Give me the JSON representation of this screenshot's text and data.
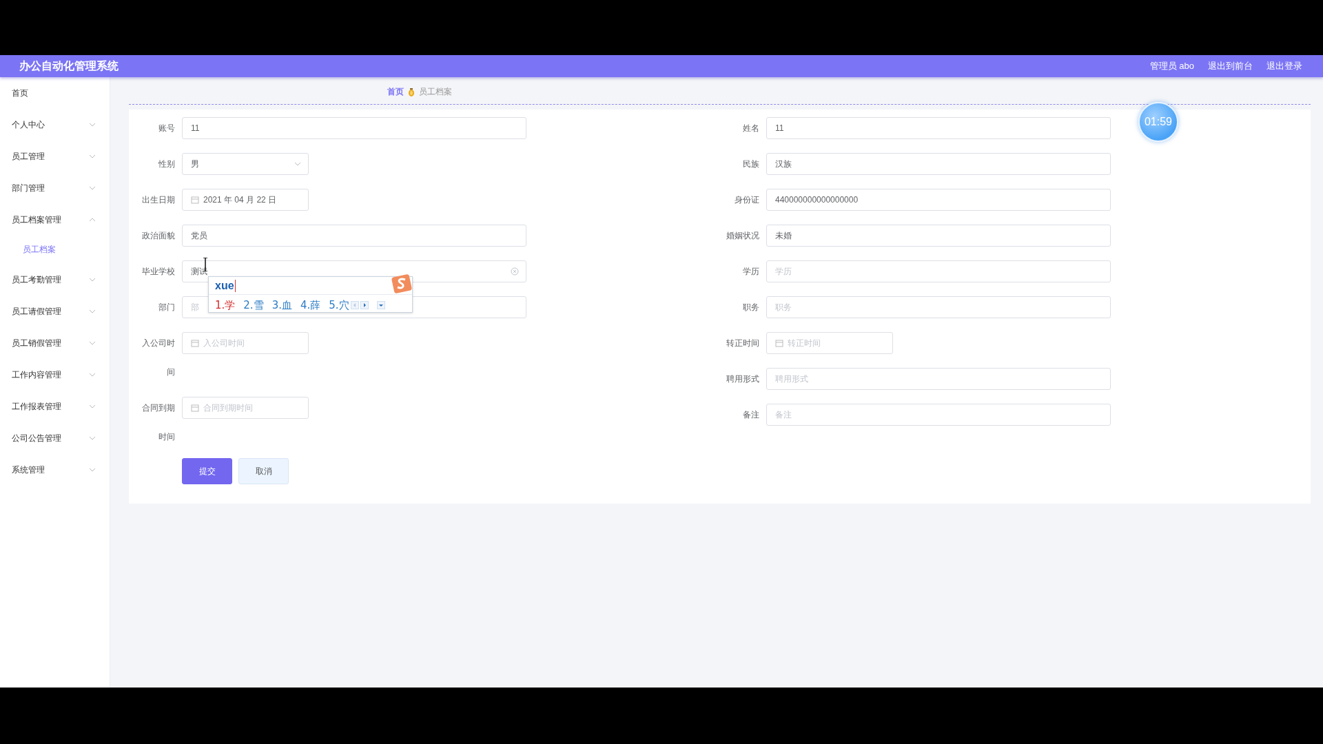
{
  "header": {
    "title": "办公自动化管理系统",
    "links": [
      "管理员 abo",
      "退出到前台",
      "退出登录"
    ]
  },
  "sidebar": {
    "items": [
      {
        "label": "首页",
        "selected": false
      },
      {
        "label": "个人中心",
        "selected": false,
        "expanded": false
      },
      {
        "label": "员工管理",
        "selected": false,
        "expanded": false
      },
      {
        "label": "部门管理",
        "selected": false,
        "expanded": false
      },
      {
        "label": "员工档案管理",
        "selected": false,
        "expanded": true,
        "children": [
          {
            "label": "员工档案",
            "selected": true
          }
        ]
      },
      {
        "label": "员工考勤管理",
        "selected": false,
        "expanded": false
      },
      {
        "label": "员工请假管理",
        "selected": false,
        "expanded": false
      },
      {
        "label": "员工销假管理",
        "selected": false,
        "expanded": false
      },
      {
        "label": "工作内容管理",
        "selected": false,
        "expanded": false
      },
      {
        "label": "工作报表管理",
        "selected": false,
        "expanded": false
      },
      {
        "label": "公司公告管理",
        "selected": false,
        "expanded": false
      },
      {
        "label": "系统管理",
        "selected": false,
        "expanded": false
      }
    ]
  },
  "breadcrumb": [
    {
      "label": "首页",
      "selected": false
    },
    {
      "label": "员工档案",
      "selected": true
    }
  ],
  "form": {
    "left_fields": [
      {
        "label": "账号",
        "kind": "text",
        "value": "11"
      },
      {
        "label": "性别",
        "kind": "select",
        "value": "男"
      },
      {
        "label": "出生日期",
        "kind": "date",
        "value": "2021 年 04 月 22 日"
      },
      {
        "label": "政治面貌",
        "kind": "text",
        "value": "党员"
      },
      {
        "label": "毕业学校",
        "kind": "text",
        "value": "测试",
        "clearable": true
      },
      {
        "label": "部门",
        "kind": "text",
        "placeholder": "部"
      },
      {
        "label": "入公司时间",
        "kind": "date",
        "placeholder": "入公司时间"
      },
      {
        "label": "合同到期时间",
        "kind": "date",
        "placeholder": "合同到期时间"
      }
    ],
    "right_fields": [
      {
        "label": "姓名",
        "kind": "text",
        "value": "11"
      },
      {
        "label": "民族",
        "kind": "text",
        "value": "汉族"
      },
      {
        "label": "身份证",
        "kind": "text",
        "value": "440000000000000000"
      },
      {
        "label": "婚姻状况",
        "kind": "text",
        "value": "未婚"
      },
      {
        "label": "学历",
        "kind": "text",
        "placeholder": "学历"
      },
      {
        "label": "职务",
        "kind": "text",
        "placeholder": "职务"
      },
      {
        "label": "转正时间",
        "kind": "date",
        "placeholder": "转正时间"
      },
      {
        "label": "聘用形式",
        "kind": "text",
        "placeholder": "聘用形式"
      },
      {
        "label": "备注",
        "kind": "text",
        "placeholder": "备注"
      }
    ],
    "buttons": [
      {
        "label": "提交",
        "kind": "primary"
      },
      {
        "label": "取消",
        "kind": "secondary"
      }
    ]
  },
  "timer": {
    "text": "01:59"
  },
  "ime": {
    "composition": "xue",
    "candidates": [
      {
        "label": "1.学",
        "selected": true
      },
      {
        "label": "2.雪",
        "selected": false
      },
      {
        "label": "3.血",
        "selected": false
      },
      {
        "label": "4.薛",
        "selected": false
      },
      {
        "label": "5.穴",
        "selected": false
      }
    ]
  }
}
